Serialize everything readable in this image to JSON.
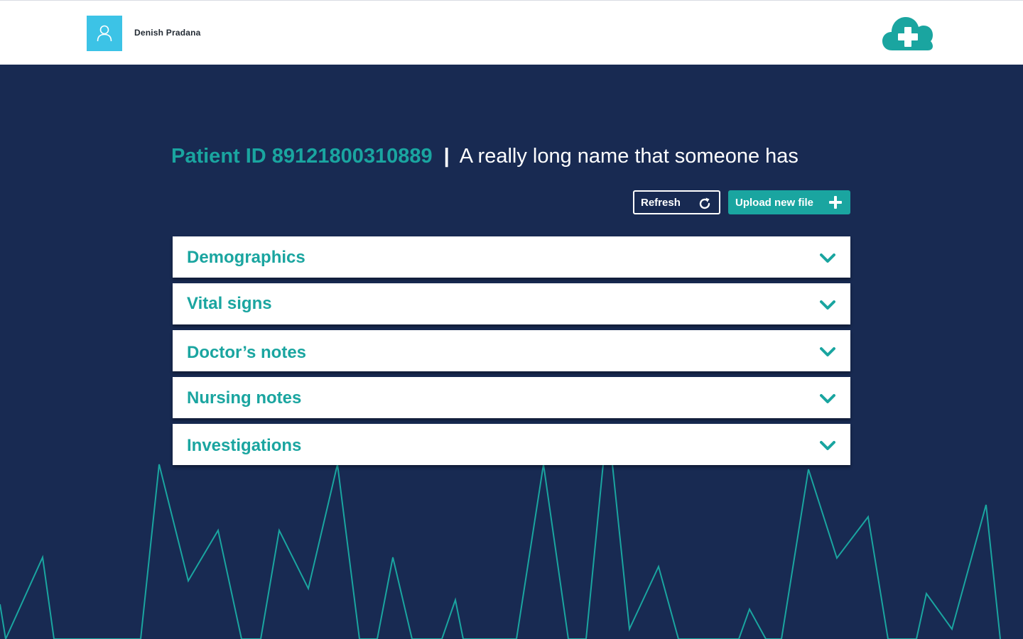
{
  "header": {
    "user_name": "Denish Pradana",
    "avatar_icon": "user-icon",
    "logo_icon": "cloud-plus-icon"
  },
  "patient": {
    "id_label": "Patient ID 89121800310889",
    "separator": "|",
    "name": "A really long name that someone has"
  },
  "actions": {
    "refresh_label": "Refresh",
    "refresh_icon": "refresh-icon",
    "upload_label": "Upload new file",
    "upload_icon": "plus-icon"
  },
  "sections": [
    {
      "label": "Demographics"
    },
    {
      "label": "Vital signs"
    },
    {
      "label": "Doctor’s notes"
    },
    {
      "label": "Nursing notes"
    },
    {
      "label": "Investigations"
    }
  ],
  "colors": {
    "background": "#182a52",
    "accent": "#1aa5a0",
    "avatar": "#3cc3e6",
    "panel": "#ffffff"
  }
}
